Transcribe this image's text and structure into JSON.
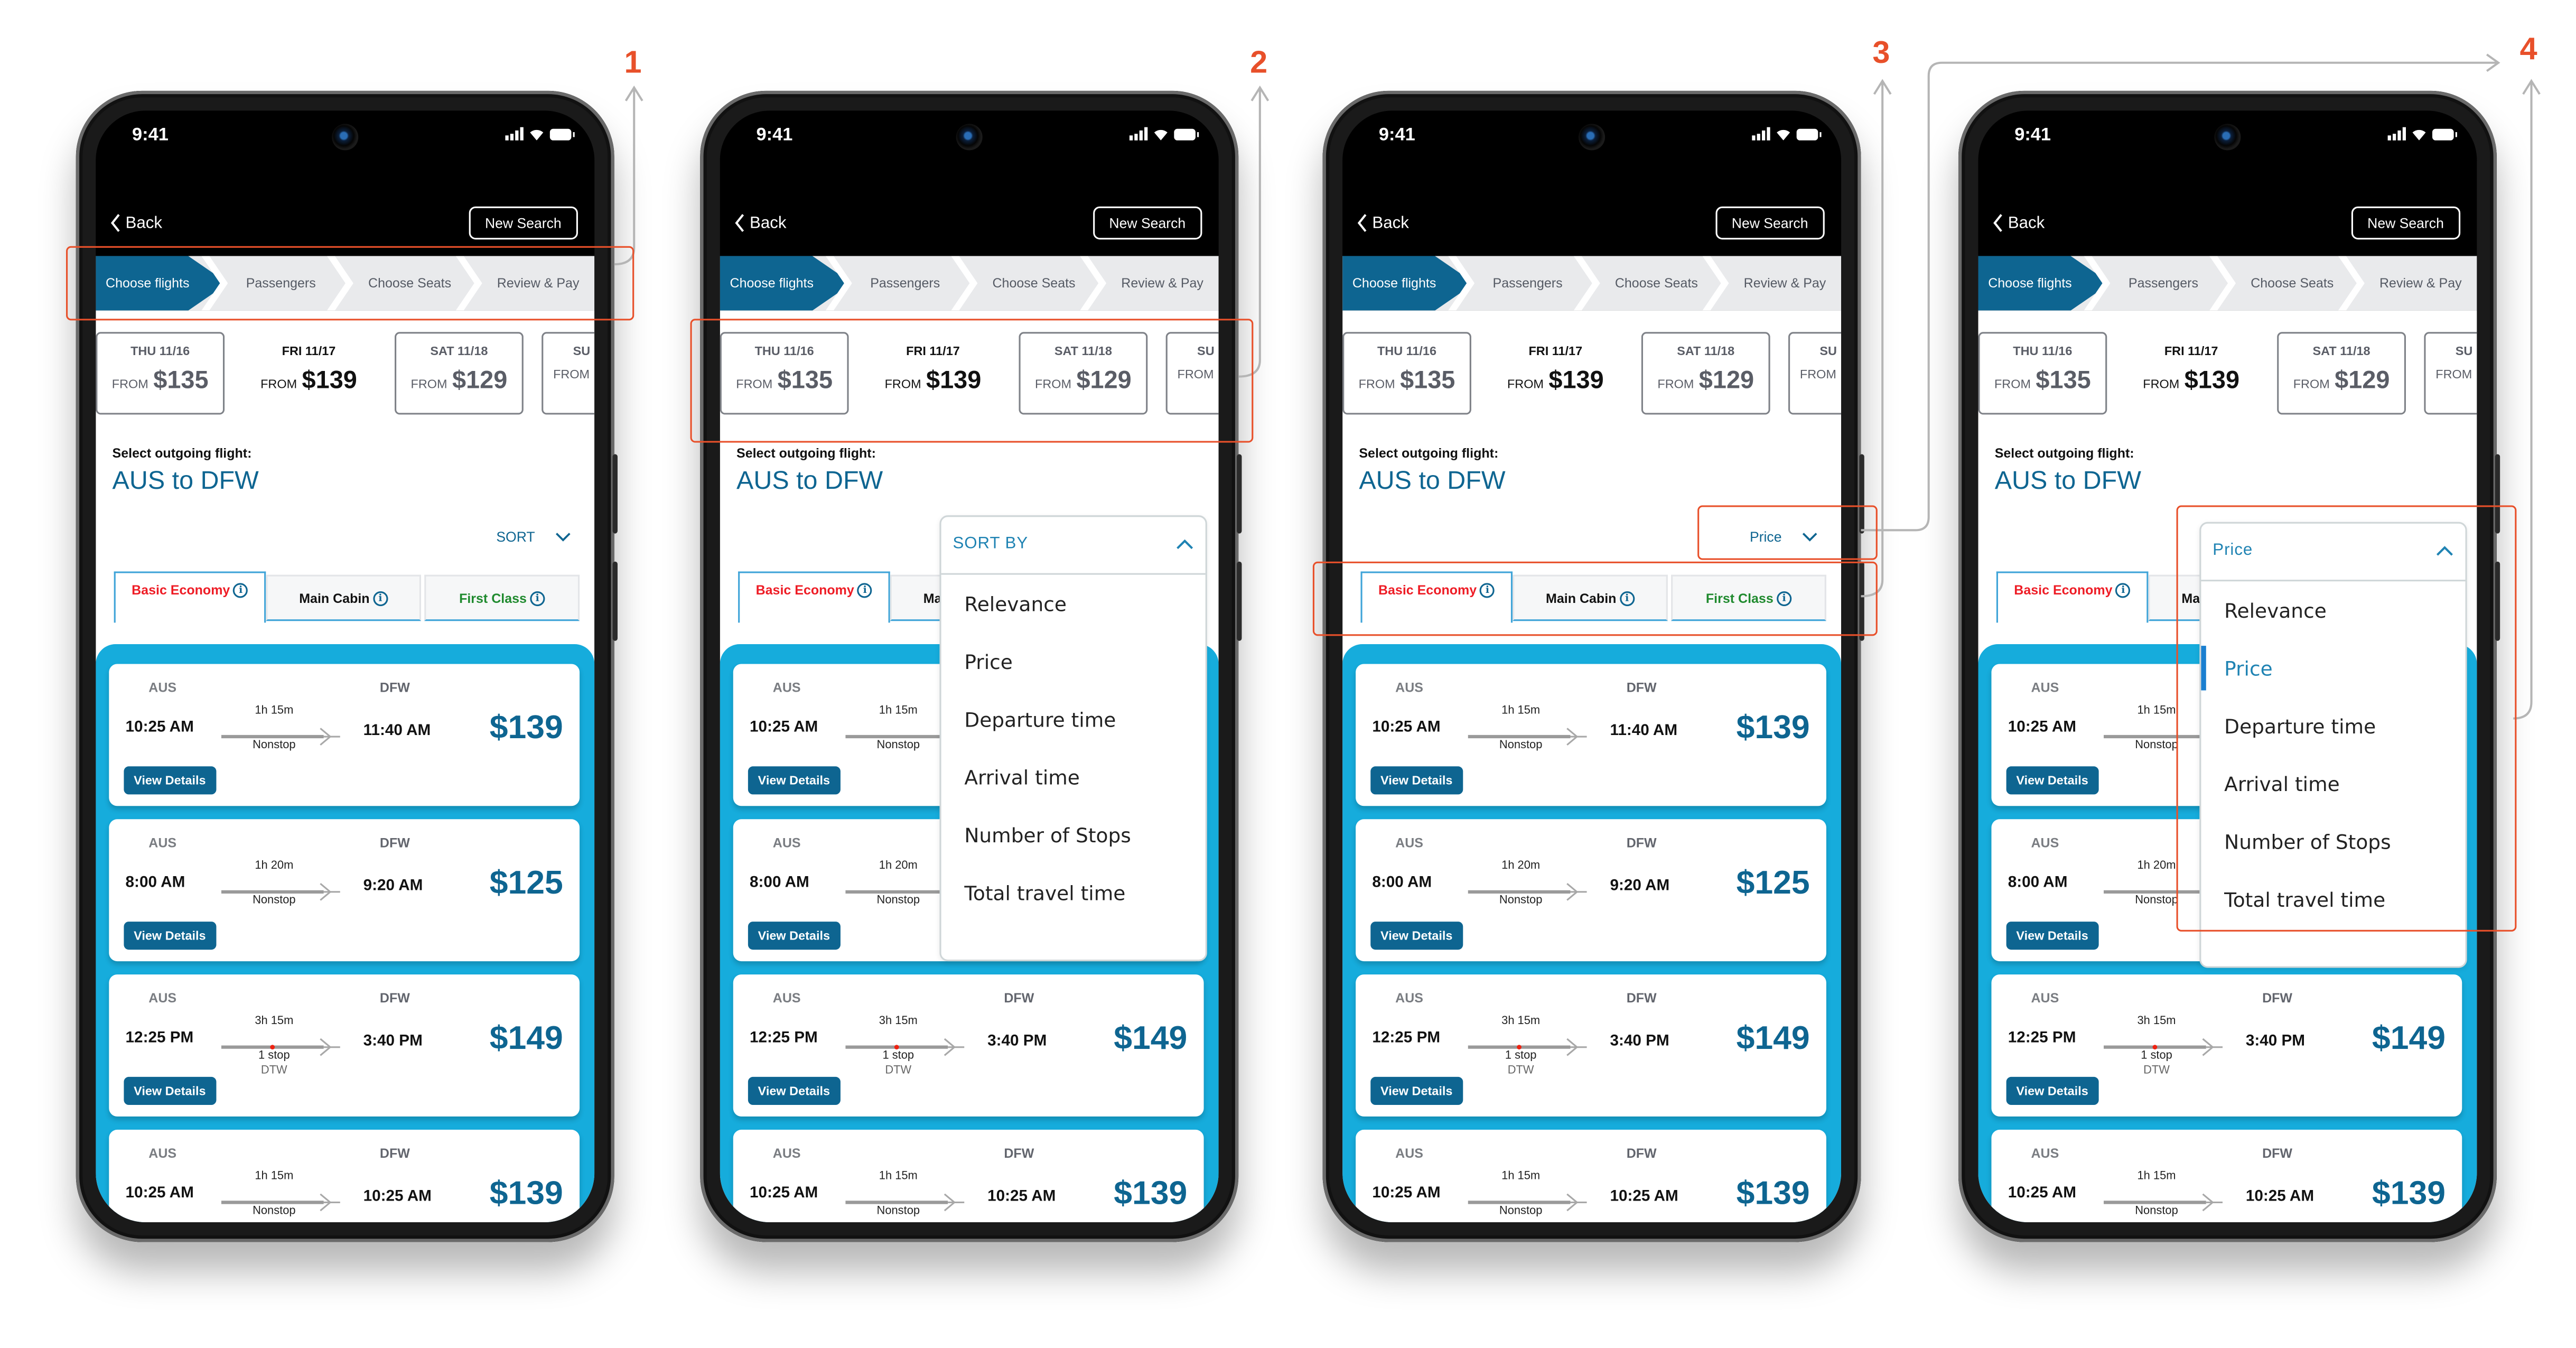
{
  "steps_annotations": [
    "1",
    "2",
    "3",
    "4"
  ],
  "status_bar": {
    "time": "9:41",
    "icons": [
      "signal-icon",
      "wifi-icon",
      "battery-icon"
    ]
  },
  "nav": {
    "back_label": "Back",
    "new_search_label": "New Search"
  },
  "stepper": {
    "steps": [
      "Choose flights",
      "Passengers",
      "Choose Seats",
      "Review & Pay"
    ],
    "active_index": 0
  },
  "dates": [
    {
      "day": "THU 11/16",
      "from": "FROM",
      "price": "$135",
      "selected": false
    },
    {
      "day": "FRI 11/17",
      "from": "FROM",
      "price": "$139",
      "selected": true
    },
    {
      "day": "SAT 11/18",
      "from": "FROM",
      "price": "$129",
      "selected": false
    },
    {
      "day": "SU",
      "from": "FROM",
      "price": "",
      "selected": false
    }
  ],
  "select_label": "Select outgoing flight:",
  "route": "AUS to DFW",
  "sort": {
    "collapsed_label": "SORT",
    "header_label": "SORT BY",
    "selected_label": "Price",
    "options": [
      "Relevance",
      "Price",
      "Departure time",
      "Arrival time",
      "Number of Stops",
      "Total travel time"
    ]
  },
  "cabin_tabs": [
    {
      "label": "Basic Economy",
      "color": "#ee1c25",
      "active": true
    },
    {
      "label": "Main Cabin",
      "color": "#111111",
      "active": false
    },
    {
      "label": "First Class",
      "color": "#1f8a2e",
      "active": false
    }
  ],
  "flights": [
    {
      "origin": "AUS",
      "dest": "DFW",
      "dep": "10:25 AM",
      "arr": "11:40 AM",
      "duration": "1h 15m",
      "stops": "Nonstop",
      "via": "",
      "price": "$139",
      "button": "View Details"
    },
    {
      "origin": "AUS",
      "dest": "DFW",
      "dep": "8:00 AM",
      "arr": "9:20 AM",
      "duration": "1h 20m",
      "stops": "Nonstop",
      "via": "",
      "price": "$125",
      "button": "View Details"
    },
    {
      "origin": "AUS",
      "dest": "DFW",
      "dep": "12:25 PM",
      "arr": "3:40 PM",
      "duration": "3h 15m",
      "stops": "1 stop",
      "via": "DTW",
      "price": "$149",
      "button": "View Details"
    },
    {
      "origin": "AUS",
      "dest": "DFW",
      "dep": "10:25 AM",
      "arr": "10:25 AM",
      "duration": "1h 15m",
      "stops": "Nonstop",
      "via": "",
      "price": "$139",
      "button": "View Details"
    }
  ],
  "colors": {
    "brand": "#0e6591",
    "results_bg": "#16acdc",
    "annotation": "#e8502a",
    "dropdown_accent": "#1f83b3"
  }
}
